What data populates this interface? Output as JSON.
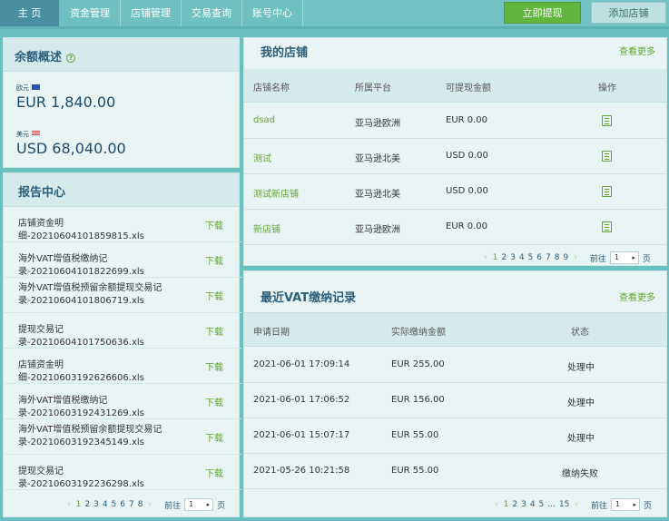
{
  "nav": {
    "items": [
      {
        "label": "主 页",
        "active": true
      },
      {
        "label": "资金管理"
      },
      {
        "label": "店铺管理"
      },
      {
        "label": "交易查询"
      },
      {
        "label": "账号中心"
      }
    ],
    "withdraw_label": "立即提现",
    "add_shop_label": "添加店铺"
  },
  "balance": {
    "title": "余额概述",
    "help_icon": "?",
    "eur_label": "欧元",
    "eur_value": "EUR 1,840.00",
    "usd_label": "美元",
    "usd_value": "USD 68,040.00"
  },
  "reports": {
    "title": "报告中心",
    "download_label": "下载",
    "items": [
      {
        "name": "店铺资金明细-20210604101859815.xls"
      },
      {
        "name": "海外VAT增值税缴纳记录-20210604101822699.xls"
      },
      {
        "name": "海外VAT增值税预留余额提现交易记录-20210604101806719.xls"
      },
      {
        "name": "提现交易记录-20210604101750636.xls"
      },
      {
        "name": "店铺资金明细-20210603192626606.xls"
      },
      {
        "name": "海外VAT增值税缴纳记录-20210603192431269.xls"
      },
      {
        "name": "海外VAT增值税预留余额提现交易记录-20210603192345149.xls"
      },
      {
        "name": "提现交易记录-20210603192236298.xls"
      }
    ],
    "pager": {
      "pages": [
        "1",
        "2",
        "3",
        "4",
        "5",
        "6",
        "7",
        "8"
      ],
      "goto_label": "前往",
      "goto_value": "1",
      "page_suffix": "页"
    }
  },
  "shops": {
    "title": "我的店铺",
    "more_label": "查看更多",
    "columns": [
      "店铺名称",
      "所属平台",
      "可提现金额",
      "操作"
    ],
    "rows": [
      {
        "name": "dsad",
        "platform": "亚马逊欧洲",
        "amount": "EUR 0.00"
      },
      {
        "name": "测试",
        "platform": "亚马逊北美",
        "amount": "USD 0.00"
      },
      {
        "name": "测试新店铺",
        "platform": "亚马逊北美",
        "amount": "USD 0.00"
      },
      {
        "name": "新店铺",
        "platform": "亚马逊欧洲",
        "amount": "EUR 0.00"
      }
    ],
    "pager": {
      "pages": [
        "1",
        "2",
        "3",
        "4",
        "5",
        "6",
        "7",
        "8",
        "9"
      ],
      "goto_label": "前往",
      "goto_value": "1",
      "page_suffix": "页"
    }
  },
  "vat": {
    "title": "最近VAT缴纳记录",
    "more_label": "查看更多",
    "columns": [
      "申请日期",
      "实际缴纳金额",
      "状态"
    ],
    "rows": [
      {
        "date": "2021-06-01 17:09:14",
        "amount": "EUR 255.00",
        "status": "处理中"
      },
      {
        "date": "2021-06-01 17:06:52",
        "amount": "EUR 156.00",
        "status": "处理中"
      },
      {
        "date": "2021-06-01 15:07:17",
        "amount": "EUR 55.00",
        "status": "处理中"
      },
      {
        "date": "2021-05-26 10:21:58",
        "amount": "EUR 55.00",
        "status": "缴纳失败"
      }
    ],
    "pager": {
      "pages": [
        "1",
        "2",
        "3",
        "4",
        "5",
        "...",
        "15"
      ],
      "goto_label": "前往",
      "goto_value": "1",
      "page_suffix": "页"
    }
  }
}
